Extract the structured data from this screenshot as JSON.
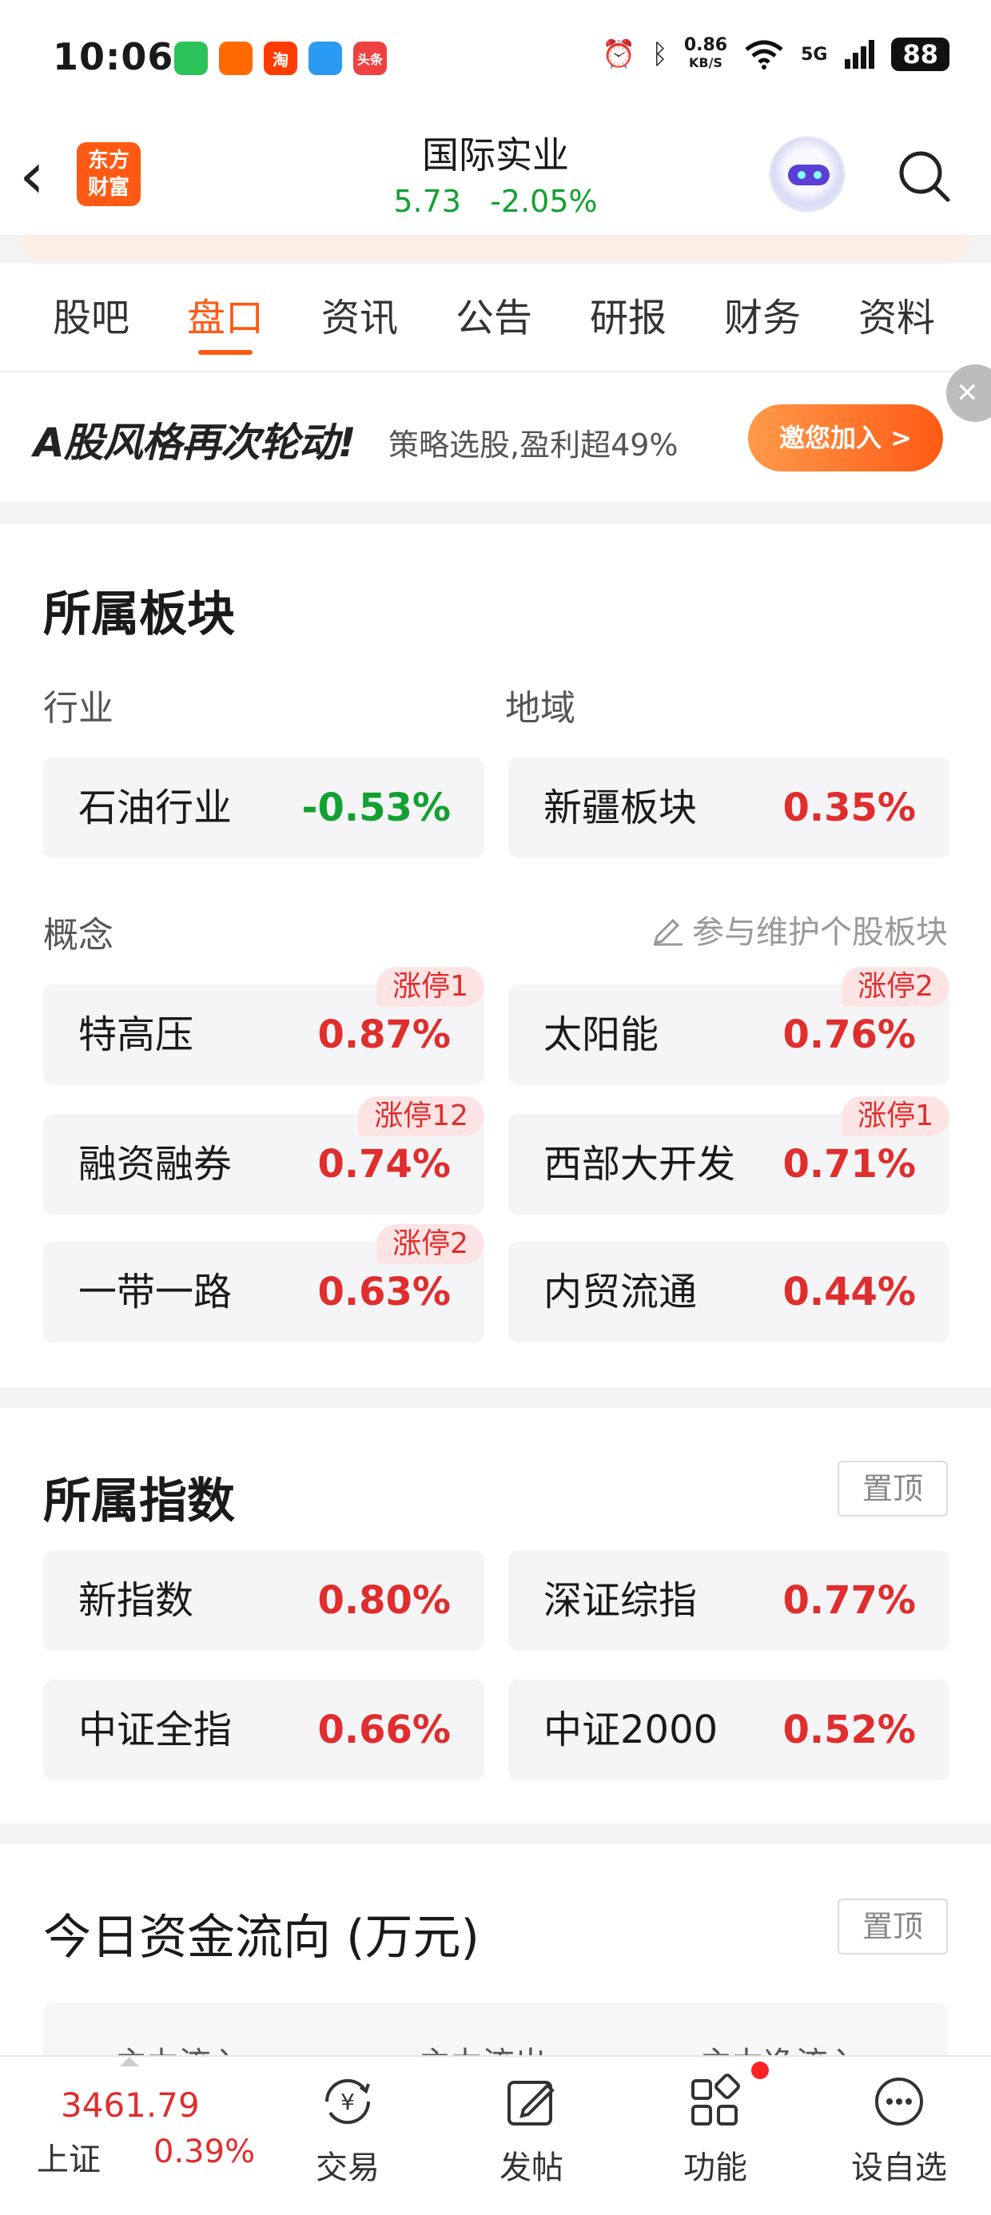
{
  "status_bar": {
    "time": "10:06",
    "apps": [
      {
        "icon": "app-green-icon",
        "text": "",
        "color": "#2bc25a"
      },
      {
        "icon": "app-orange-icon",
        "text": "",
        "color": "#ff6a00"
      },
      {
        "icon": "taobao-icon",
        "text": "淘",
        "color": "#ff3c00"
      },
      {
        "icon": "paper-plane-icon",
        "text": "",
        "color": "#2b9af3"
      },
      {
        "icon": "toutiao-icon",
        "text": "头条",
        "color": "#f04142"
      }
    ],
    "speed_value": "0.86",
    "speed_unit": "KB/S",
    "network": "5G",
    "battery": "88"
  },
  "nav": {
    "logo_line1": "东方",
    "logo_line2": "财富",
    "stock_name": "国际实业",
    "price_line": "5.73   -2.05%"
  },
  "tabs": [
    "股吧",
    "盘口",
    "资讯",
    "公告",
    "研报",
    "财务",
    "资料"
  ],
  "active_tab": 1,
  "banner": {
    "title": "A股风格再次轮动!",
    "subtitle": "策略选股,盈利超49%",
    "button": "邀您加入 >",
    "close": "✕"
  },
  "sectors": {
    "title": "所属板块",
    "industry_label": "行业",
    "region_label": "地域",
    "concept_label": "概念",
    "maintain_link": "参与维护个股板块",
    "industry": {
      "name": "石油行业",
      "pct": "-0.53%"
    },
    "region": {
      "name": "新疆板块",
      "pct": "0.35%"
    },
    "concepts": [
      {
        "name": "特高压",
        "pct": "0.87%",
        "badge": "涨停1"
      },
      {
        "name": "太阳能",
        "pct": "0.76%",
        "badge": "涨停2"
      },
      {
        "name": "融资融券",
        "pct": "0.74%",
        "badge": "涨停12"
      },
      {
        "name": "西部大开发",
        "pct": "0.71%",
        "badge": "涨停1"
      },
      {
        "name": "一带一路",
        "pct": "0.63%",
        "badge": "涨停2"
      },
      {
        "name": "内贸流通",
        "pct": "0.44%",
        "badge": ""
      }
    ]
  },
  "indices": {
    "title": "所属指数",
    "pin": "置顶",
    "items": [
      {
        "name": "新指数",
        "pct": "0.80%"
      },
      {
        "name": "深证综指",
        "pct": "0.77%"
      },
      {
        "name": "中证全指",
        "pct": "0.66%"
      },
      {
        "name": "中证2000",
        "pct": "0.52%"
      }
    ]
  },
  "fund_flow": {
    "title": "今日资金流向 (万元)",
    "pin": "置顶",
    "columns": [
      "主力流入",
      "主力流出",
      "主力净流入"
    ]
  },
  "bottom": {
    "index_value": "3461.79",
    "index_name": "上证",
    "index_pct": "0.39%",
    "items": [
      "交易",
      "发帖",
      "功能",
      "设自选"
    ]
  },
  "colors": {
    "accent": "#ff5a14",
    "up": "#e02d2d",
    "down": "#13a032"
  }
}
